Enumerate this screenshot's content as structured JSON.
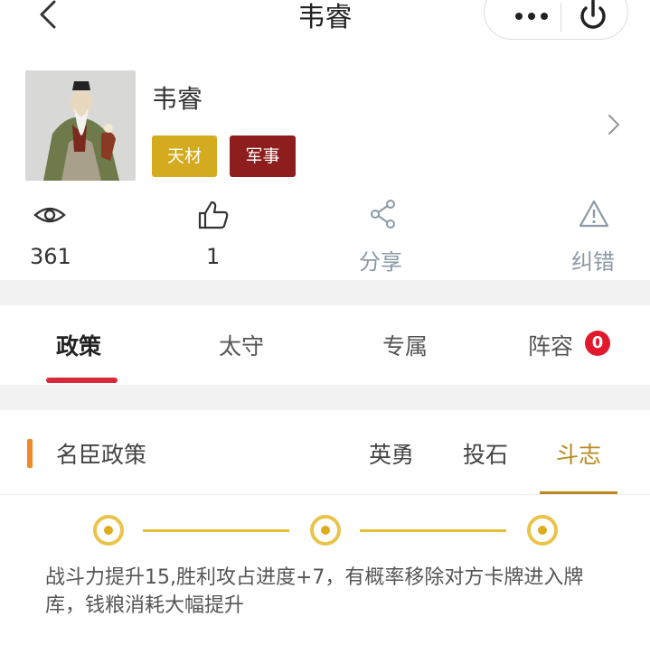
{
  "nav": {
    "title": "韦睿",
    "back_icon": "chevron-left-icon",
    "more_icon": "more-dots-icon",
    "power_icon": "power-icon"
  },
  "profile": {
    "name": "韦睿",
    "tags": [
      {
        "label": "天材",
        "color": "#d4aa1e"
      },
      {
        "label": "军事",
        "color": "#8e1d1d"
      }
    ]
  },
  "stats": {
    "views": "361",
    "likes": "1",
    "share_label": "分享",
    "report_label": "纠错"
  },
  "tabs": [
    {
      "label": "政策",
      "active": true
    },
    {
      "label": "太守",
      "active": false
    },
    {
      "label": "专属",
      "active": false
    },
    {
      "label": "阵容",
      "active": false,
      "badge": "0"
    }
  ],
  "policy": {
    "title": "名臣政策",
    "sub_tabs": [
      {
        "label": "英勇",
        "active": false
      },
      {
        "label": "投石",
        "active": false
      },
      {
        "label": "斗志",
        "active": true
      }
    ],
    "description": "战斗力提升15,胜利攻占进度+7，有概率移除对方卡牌进入牌库，钱粮消耗大幅提升"
  },
  "colors": {
    "accent_red": "#d7283c",
    "gold": "#b88920",
    "orange_marker": "#ef8a26",
    "badge_red": "#e2182c"
  }
}
